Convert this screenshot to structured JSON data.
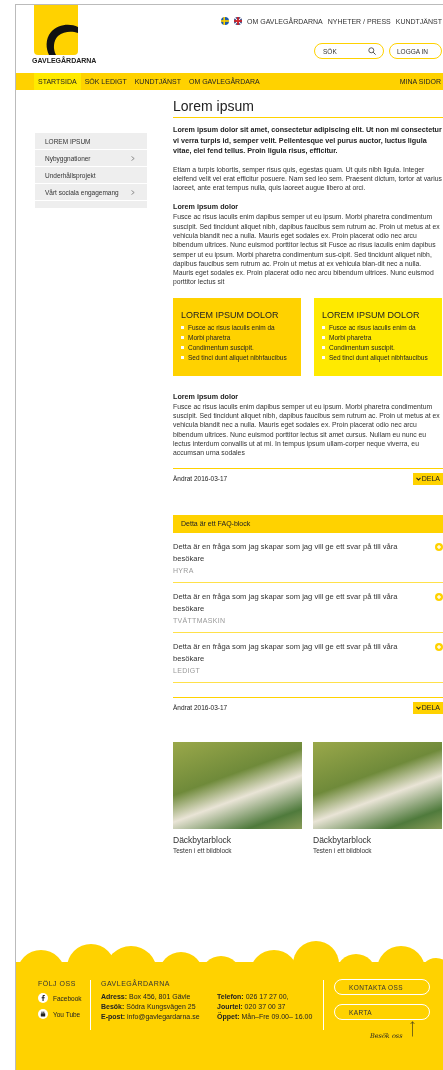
{
  "header": {
    "logo_text": "GAVLEGÅRDARNA",
    "languages": [
      {
        "kind": "swedish"
      },
      {
        "kind": "english"
      }
    ],
    "top_links": [
      "OM GAVLEGÅRDARNA",
      "NYHETER / PRESS",
      "KUNDTJÄNST"
    ],
    "search": {
      "placeholder": "SÖK"
    },
    "login_button": "LOGGA IN"
  },
  "nav": {
    "items": [
      {
        "label": "STARTSIDA",
        "selected": true
      },
      {
        "label": "SÖK LEDIGT",
        "selected": false
      },
      {
        "label": "KUNDTJÄNST",
        "selected": false
      },
      {
        "label": "OM GAVLEGÅRDARA",
        "selected": false
      }
    ],
    "right_link": "MINA SIDOR"
  },
  "sidebar": {
    "items": [
      {
        "label": "LOREM IPSUM",
        "expandable": false
      },
      {
        "label": "Nybyggnationer",
        "expandable": true
      },
      {
        "label": "Underhållsprojekt",
        "expandable": false
      },
      {
        "label": "Vårt sociala engagemang",
        "expandable": true
      }
    ]
  },
  "article": {
    "title": "Lorem ipsum",
    "lead": "Lorem ipsum dolor sit amet, consectetur adipiscing elit. Ut non mi consectetur vi verra turpis id, semper velit. Pellentesque vel purus auctor, luctus ligula vitae, elei fend tellus. Proin ligula risus, efficitur.",
    "intro": "Etiam a turpis lobortis, semper risus quis, egestas quam. Ut quis nibh ligula. Integer eleifend velit vel erat efficitur posuere. Nam sed leo sem. Praesent dictum, tortor at varius laoreet, ante erat tempus nulla, quis laoreet augue libero at orci.",
    "section_1": {
      "heading": "Lorem ipsum dolor",
      "body": "Fusce ac risus iaculis enim dapibus semper ut eu ipsum. Morbi pharetra condimentum suscipit. Sed tincidunt aliquet nibh, dapibus faucibus sem rutrum ac. Proin ut metus at ex vehicula blandit nec a nulla. Mauris eget sodales ex. Proin placerat odio nec arcu bibendum ultrices. Nunc euismod porttitor lectus sit Fusce ac risus iaculis enim dapibus semper ut eu ipsum. Morbi pharetra condimentum sus-cipit. Sed tincidunt aliquet nibh, dapibus faucibus sem rutrum ac. Proin ut metus at ex vehicula blan-dit nec a nulla. Mauris eget sodales ex. Proin placerat odio nec arcu bibendum ultrices. Nunc euismod porttitor lectus sit"
    },
    "boxes": [
      {
        "title": "LOREM IPSUM DOLOR",
        "color": "#ffd200",
        "items": [
          "Fusce ac risus iaculis enim da",
          "Morbi pharetra",
          "Condimentum suscipit.",
          "Sed tinci dunt aliquet nibhfaucibus"
        ]
      },
      {
        "title": "LOREM IPSUM DOLOR",
        "color": "#ffea00",
        "items": [
          "Fusce ac risus iaculis enim da",
          "Morbi pharetra",
          "Condimentum suscipit.",
          "Sed tinci dunt aliquet nibhfaucibus"
        ]
      }
    ],
    "section_2": {
      "heading": "Lorem ipsum dolor",
      "body": "Fusce ac risus iaculis enim dapibus semper ut eu ipsum. Morbi pharetra condimentum suscipit. Sed tincidunt aliquet nibh, dapibus faucibus sem rutrum ac. Proin ut metus at ex vehicula blandit nec a nulla. Mauris eget sodales ex. Proin placerat odio nec arcu bibendum ultrices. Nunc euismod porttitor lectus sit amet cursus. Nullam eu nunc eu lectus interdum convallis ut at mi. In tempus ipsum ullam-corper neque viverra, eu accumsan urna sodales"
    },
    "meta_1": {
      "changed": "Ändrat 2016-03-17",
      "share_button": "DELA"
    }
  },
  "faq": {
    "title": "Detta är ett FAQ-block",
    "items": [
      {
        "question": "Detta är en fråga som jag skapar som jag vill ge ett svar på till våra besökare",
        "tag": "HYRA",
        "expanded": false
      },
      {
        "question": "Detta är en fråga som jag skapar som jag vill ge ett svar på till våra besökare",
        "tag": "TVÄTTMASKIN",
        "expanded": false
      },
      {
        "question": "Detta är en fråga som jag skapar som jag vill ge ett svar på till våra besökare",
        "tag": "LEDIGT",
        "expanded": false
      }
    ],
    "meta": {
      "changed": "Ändrat 2016-03-17",
      "share_button": "DELA"
    }
  },
  "image_cards": [
    {
      "title": "Däckbytarblock",
      "caption": "Testen i ett bildblock"
    },
    {
      "title": "Däckbytarblock",
      "caption": "Testen i ett bildblock"
    }
  ],
  "footer": {
    "follow_title": "FÖLJ OSS",
    "social": [
      {
        "kind": "facebook",
        "label": "Facebook"
      },
      {
        "kind": "youtube",
        "label": "You Tube"
      }
    ],
    "company_title": "GAVLEGÅRDARNA",
    "contact_rows": [
      "**Adress:** Box 456, 801 Gävle",
      "**Telefon:** 026 17 27 00,",
      "**Besök:** Södra Kungsvägen 25",
      "**Jourtel:** 020 37 00 37",
      "**E-post:** info@gavlegardarna.se",
      "**Öppet:** Mån–Fre 09.00– 16.00"
    ],
    "buttons": [
      "KONTAKTA OSS",
      "KARTA"
    ],
    "visit_note": "Besök oss"
  }
}
